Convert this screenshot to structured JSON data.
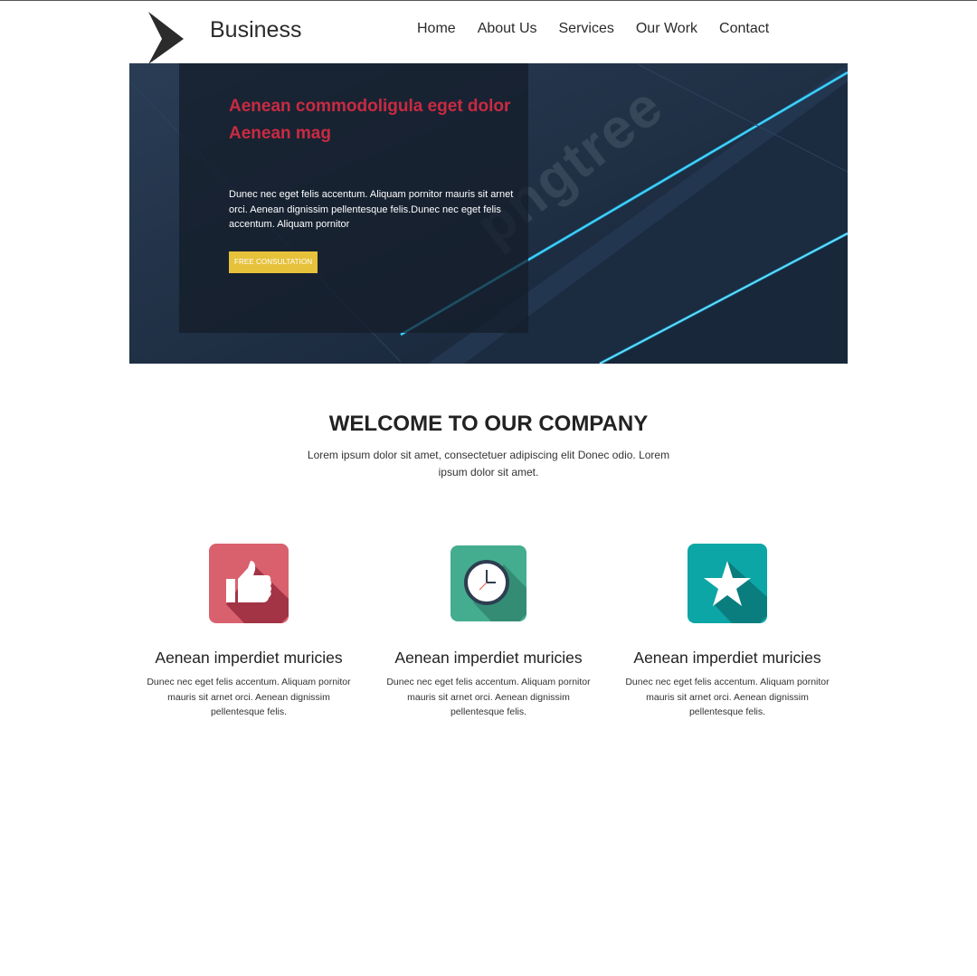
{
  "header": {
    "brand": "Business",
    "nav": [
      "Home",
      "About Us",
      "Services",
      "Our Work",
      "Contact"
    ]
  },
  "hero": {
    "title": "Aenean commodoligula eget dolor Aenean mag",
    "text": "Dunec nec eget felis accentum. Aliquam pornitor mauris sit arnet orci. Aenean dignissim pellentesque felis.Dunec nec eget felis accentum. Aliquam pornitor",
    "button": "FREE CONSULTATION",
    "watermark": "pngtree"
  },
  "welcome": {
    "title": "WELCOME TO OUR COMPANY",
    "subtitle": "Lorem ipsum dolor sit amet, consectetuer adipiscing elit Donec odio. Lorem ipsum dolor sit amet."
  },
  "features": [
    {
      "icon": "thumbs-up-icon",
      "color": "#d9616e",
      "title": "Aenean imperdiet muricies",
      "text": "Dunec nec eget felis accentum. Aliquam pornitor mauris sit arnet orci. Aenean dignissim pellentesque felis."
    },
    {
      "icon": "clock-icon",
      "color": "#44ad8f",
      "title": "Aenean imperdiet muricies",
      "text": "Dunec nec eget felis accentum. Aliquam pornitor mauris sit arnet orci. Aenean dignissim pellentesque felis."
    },
    {
      "icon": "star-icon",
      "color": "#0da6a6",
      "title": "Aenean imperdiet muricies",
      "text": "Dunec nec eget felis accentum. Aliquam pornitor mauris sit arnet orci. Aenean dignissim pellentesque felis."
    }
  ],
  "colors": {
    "accent_red": "#c92a42",
    "button_yellow": "#e6c13a",
    "hero_dark": "#1c2c40"
  }
}
